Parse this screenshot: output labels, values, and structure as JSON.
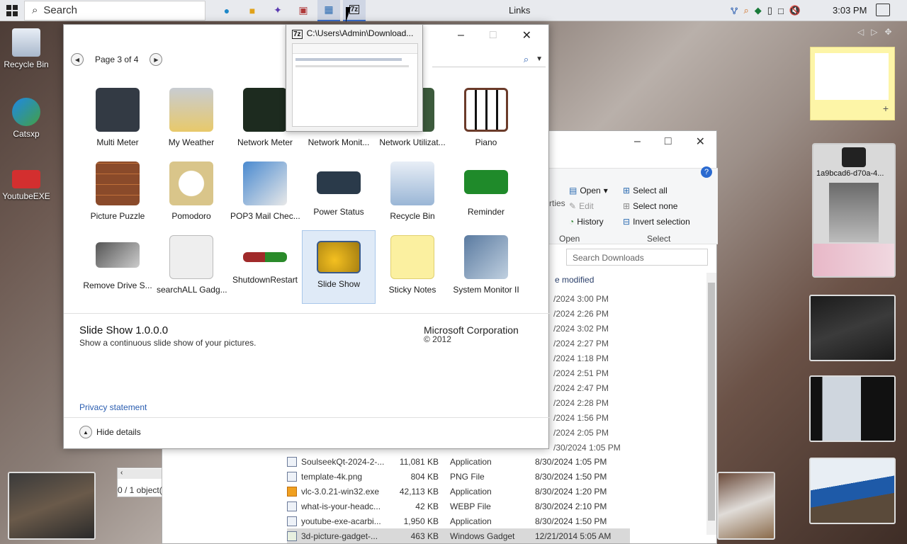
{
  "taskbar": {
    "search_placeholder": "Search",
    "links_label": "Links",
    "clock": "3:03 PM",
    "apps": [
      "edge-icon",
      "file-explorer-icon",
      "gadget-app-icon",
      "photo-app-icon",
      "control-panel-icon",
      "7zip-icon"
    ]
  },
  "desktop": {
    "icons": [
      {
        "label": "Recycle Bin"
      },
      {
        "label": "Catsxp"
      },
      {
        "label": "YoutubeEXE"
      }
    ]
  },
  "thumbnail_popup": {
    "title": "C:\\Users\\Admin\\Download..."
  },
  "gallery": {
    "page_label": "Page 3 of 4",
    "gadgets": [
      {
        "name": "Multi Meter",
        "color": "#333a44"
      },
      {
        "name": "My Weather",
        "color": "#c8a24a"
      },
      {
        "name": "Network Meter",
        "color": "#1d2b1f"
      },
      {
        "name": "Network Monit...",
        "color": "#2f3d2f"
      },
      {
        "name": "Network Utilizat...",
        "color": "#3c5a3c"
      },
      {
        "name": "Piano",
        "color": "#6b3b2a"
      },
      {
        "name": "Picture Puzzle",
        "color": "#8a4a2a"
      },
      {
        "name": "Pomodoro",
        "color": "#d9c58a"
      },
      {
        "name": "POP3 Mail Chec...",
        "color": "#4a8ad0"
      },
      {
        "name": "Power Status",
        "color": "#2a3a4a"
      },
      {
        "name": "Recycle Bin",
        "color": "#9ab6d6"
      },
      {
        "name": "Reminder",
        "color": "#1f8a2a"
      },
      {
        "name": "Remove Drive S...",
        "color": "#8c8c8c"
      },
      {
        "name": "searchALL Gadg...",
        "color": "#e6e6e6"
      },
      {
        "name": "ShutdownRestart",
        "color": "#a02a2a"
      },
      {
        "name": "Slide Show",
        "color": "#d9a21f"
      },
      {
        "name": "Sticky Notes",
        "color": "#fbf0a0"
      },
      {
        "name": "System Monitor II",
        "color": "#5a7aa0"
      }
    ],
    "selected_index": 15,
    "details": {
      "title": "Slide Show 1.0.0.0",
      "description": "Show a continuous slide show of your pictures.",
      "publisher": "Microsoft Corporation",
      "copyright": "© 2012",
      "privacy_link": "Privacy statement",
      "hide_details": "Hide details"
    }
  },
  "explorer": {
    "ribbon": {
      "open": "Open",
      "edit": "Edit",
      "history": "History",
      "select_all": "Select all",
      "select_none": "Select none",
      "invert_selection": "Invert selection",
      "properties_fragment": "rties",
      "group_open": "Open",
      "group_select": "Select"
    },
    "search_placeholder": "Search Downloads",
    "column_modified": "e modified",
    "hidden_dates": [
      "/2024 3:00 PM",
      "/2024 2:26 PM",
      "/2024 3:02 PM",
      "/2024 2:27 PM",
      "/2024 1:18 PM",
      "/2024 2:51 PM",
      "/2024 2:47 PM",
      "/2024 2:28 PM",
      "/2024 1:56 PM",
      "/2024 2:05 PM"
    ],
    "files": [
      {
        "name": "SoulseekQt-2024-2-...",
        "size": "11,081 KB",
        "type": "Application",
        "date": "8/30/2024 1:05 PM"
      },
      {
        "name": "template-4k.png",
        "size": "804 KB",
        "type": "PNG File",
        "date": "8/30/2024 1:50 PM"
      },
      {
        "name": "vlc-3.0.21-win32.exe",
        "size": "42,113 KB",
        "type": "Application",
        "date": "8/30/2024 1:20 PM"
      },
      {
        "name": "what-is-your-headc...",
        "size": "42 KB",
        "type": "WEBP File",
        "date": "8/30/2024 2:10 PM"
      },
      {
        "name": "youtube-exe-acarbi...",
        "size": "1,950 KB",
        "type": "Application",
        "date": "8/30/2024 1:50 PM"
      },
      {
        "name": "3d-picture-gadget-...",
        "size": "463 KB",
        "type": "Windows Gadget",
        "date": "12/21/2014 5:05 AM"
      }
    ],
    "partial_row_date": "/30/2024 1:05 PM",
    "status": "0 / 1 object("
  },
  "sidebar": {
    "photo_caption": "1a9bcad6-d70a-4..."
  }
}
